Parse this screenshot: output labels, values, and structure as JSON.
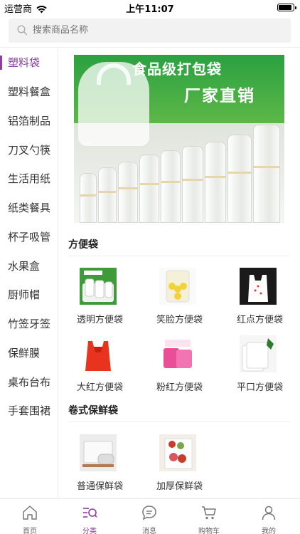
{
  "status": {
    "carrier": "运营商",
    "time": "上午11:07"
  },
  "search": {
    "placeholder": "搜索商品名称"
  },
  "sidebar": {
    "items": [
      {
        "label": "塑料袋",
        "active": true
      },
      {
        "label": "塑料餐盒"
      },
      {
        "label": "铝箔制品"
      },
      {
        "label": "刀叉勺筷"
      },
      {
        "label": "生活用纸"
      },
      {
        "label": "纸类餐具"
      },
      {
        "label": "杯子吸管"
      },
      {
        "label": "水果盒"
      },
      {
        "label": "厨师帽"
      },
      {
        "label": "竹签牙签"
      },
      {
        "label": "保鲜膜"
      },
      {
        "label": "桌布台布"
      },
      {
        "label": "手套围裙"
      }
    ]
  },
  "banner": {
    "title": "食品级打包袋",
    "subtitle": "厂家直销"
  },
  "sections": [
    {
      "title": "方便袋",
      "products": [
        {
          "name": "透明方便袋",
          "icon": "clear-bag-image"
        },
        {
          "name": "笑脸方便袋",
          "icon": "smiley-bag-image"
        },
        {
          "name": "红点方便袋",
          "icon": "red-dot-bag-image"
        },
        {
          "name": "大红方便袋",
          "icon": "red-bag-image"
        },
        {
          "name": "粉红方便袋",
          "icon": "pink-bag-image"
        },
        {
          "name": "平口方便袋",
          "icon": "flat-bag-image"
        }
      ]
    },
    {
      "title": "卷式保鲜袋",
      "products": [
        {
          "name": "普通保鲜袋",
          "icon": "roll-bag-image"
        },
        {
          "name": "加厚保鲜袋",
          "icon": "thick-bag-image"
        }
      ]
    }
  ],
  "tabs": [
    {
      "label": "首页",
      "icon": "home-icon"
    },
    {
      "label": "分类",
      "icon": "category-icon",
      "active": true
    },
    {
      "label": "消息",
      "icon": "message-icon"
    },
    {
      "label": "购物车",
      "icon": "cart-icon"
    },
    {
      "label": "我的",
      "icon": "profile-icon"
    }
  ],
  "colors": {
    "accent": "#8b3fa5",
    "banner_green": "#2aa140"
  }
}
